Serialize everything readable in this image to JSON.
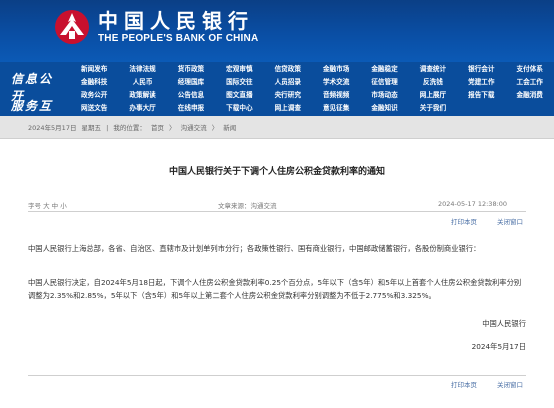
{
  "header": {
    "logo_cn": "中国人民银行",
    "logo_en": "THE PEOPLE'S BANK OF CHINA",
    "brand_color": "#0a4d9c"
  },
  "nav": {
    "side_labels": [
      "信息公开",
      "服务互动"
    ],
    "items": [
      "新闻发布",
      "法律法规",
      "货币政策",
      "宏观审慎",
      "信贷政策",
      "金融市场",
      "金融稳定",
      "调查统计",
      "银行会计",
      "支付体系",
      "金融科技",
      "人民币",
      "经理国库",
      "国际交往",
      "人员招录",
      "学术交流",
      "征信管理",
      "反洗钱",
      "党建工作",
      "工会工作",
      "政务公开",
      "政策解读",
      "公告信息",
      "图文直播",
      "央行研究",
      "音频视频",
      "市场动态",
      "网上展厅",
      "报告下载",
      "金融消费",
      "网送文告",
      "办事大厅",
      "在线申报",
      "下载中心",
      "网上调查",
      "意见征集",
      "金融知识",
      "关于我们",
      "",
      ""
    ]
  },
  "breadcrumb": {
    "date": "2024年5月17日",
    "weekday": "星期五",
    "location_label": "我的位置：",
    "path": [
      "首页",
      "沟通交流",
      "新闻"
    ],
    "separator": "〉"
  },
  "article": {
    "title": "中国人民银行关于下调个人住房公积金贷款利率的通知",
    "font_label": "字号",
    "font_sizes": [
      "大",
      "中",
      "小"
    ],
    "source": "文章来源：沟通交流",
    "datetime": "2024-05-17  12:38:00",
    "print_label": "打印本页",
    "close_label": "关闭窗口",
    "para1": "中国人民银行上海总部，各省、自治区、直辖市及计划单列市分行；各政策性银行、国有商业银行，中国邮政储蓄银行，各股份制商业银行：",
    "para2": "中国人民银行决定，自2024年5月18日起，下调个人住房公积金贷款利率0.25个百分点，5年以下（含5年）和5年以上首套个人住房公积金贷款利率分别调整为2.35%和2.85%，5年以下（含5年）和5年以上第二套个人住房公积金贷款利率分别调整为不低于2.775%和3.325%。",
    "sign_org": "中国人民银行",
    "sign_date": "2024年5月17日"
  }
}
